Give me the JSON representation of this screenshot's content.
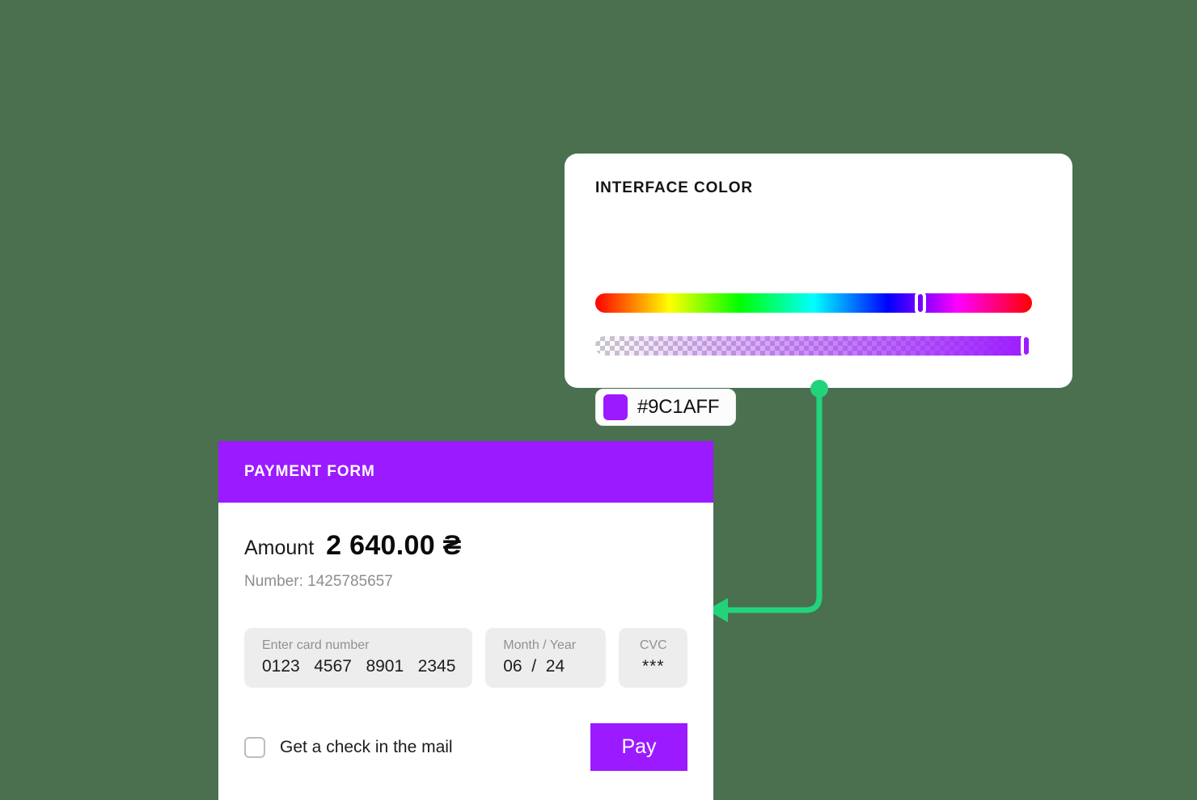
{
  "theme": {
    "background_color": "#4A7050",
    "accent_color": "#9C1AFF",
    "connector_color": "#22D37C"
  },
  "color_panel": {
    "title": "INTERFACE COLOR",
    "hex_value": "#9C1AFF",
    "swatch_color": "#9C1AFF",
    "eyedropper_icon": "eyedropper-icon",
    "hue_slider": {
      "name": "hue-slider",
      "handle_position_percent": 75
    },
    "alpha_slider": {
      "name": "alpha-slider",
      "handle_position_percent": 100,
      "fill_color": "#9C1AFF"
    }
  },
  "payment_form": {
    "header_title": "PAYMENT FORM",
    "header_color": "#9C1AFF",
    "amount_label": "Amount",
    "amount_value": "2 640.00 ₴",
    "order_number": "Number: 1425785657",
    "fields": [
      {
        "name": "card-number",
        "label": "Enter card number",
        "value": "0123   4567   8901   2345"
      },
      {
        "name": "expiry",
        "label": "Month / Year",
        "value": "06  /  24"
      },
      {
        "name": "cvc",
        "label": "CVC",
        "value": "***"
      }
    ],
    "checkbox": {
      "label": "Get a check in the mail",
      "checked": false
    },
    "pay_button_label": "Pay",
    "pay_button_color": "#9C1AFF"
  }
}
